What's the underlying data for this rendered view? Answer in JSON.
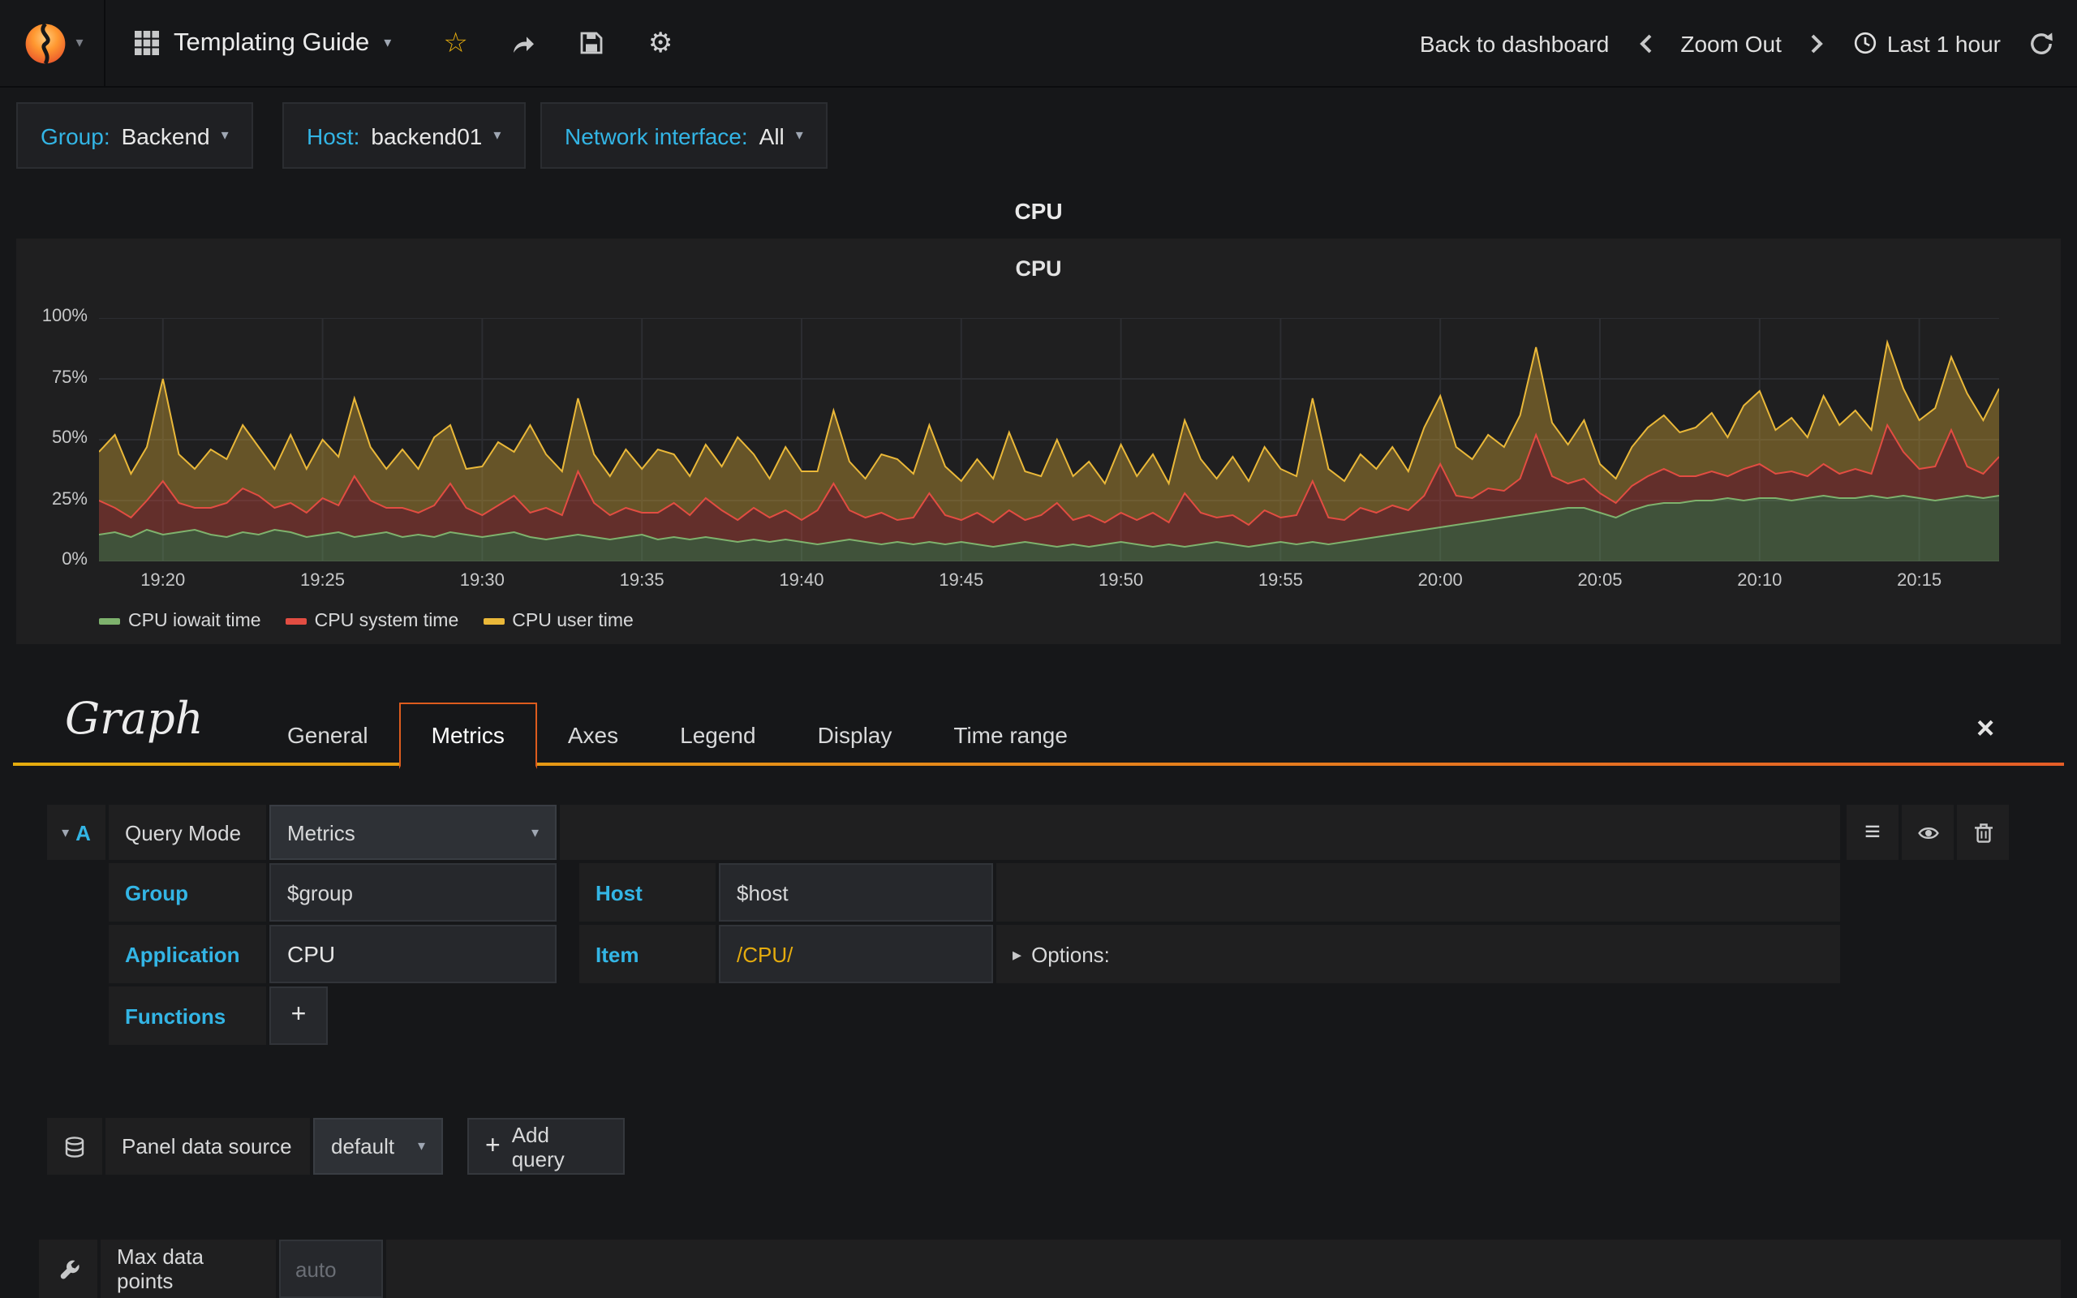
{
  "navbar": {
    "dashboard_title": "Templating Guide",
    "back_to_dashboard": "Back to dashboard",
    "zoom_out": "Zoom Out",
    "time_range": "Last 1 hour"
  },
  "icons": {
    "star": "☆",
    "gear": "⚙",
    "caret_down": "▾",
    "caret_right": "▸",
    "close": "×",
    "plus": "+",
    "hamburger": "≡"
  },
  "colors": {
    "accent_cyan": "#33b5e5",
    "accent_orange": "#e55e27",
    "regex_yellow": "#e5ac0e",
    "panel_bg": "#1f1f20",
    "page_bg": "#161719"
  },
  "variables": [
    {
      "label": "Group:",
      "value": "Backend"
    },
    {
      "label": "Host:",
      "value": "backend01"
    },
    {
      "label": "Network interface:",
      "value": "All"
    }
  ],
  "panel": {
    "title": "CPU",
    "chart_title": "CPU"
  },
  "chart_data": {
    "type": "area",
    "stacked": true,
    "title": "CPU",
    "ylabel": "",
    "xlabel": "",
    "unit": "%",
    "ylim": [
      0,
      100
    ],
    "yticks": [
      "0%",
      "25%",
      "50%",
      "75%",
      "100%"
    ],
    "x_start": "19:18",
    "span_minutes": 59.5,
    "xticks": [
      {
        "min": 2,
        "label": "19:20"
      },
      {
        "min": 7,
        "label": "19:25"
      },
      {
        "min": 12,
        "label": "19:30"
      },
      {
        "min": 17,
        "label": "19:35"
      },
      {
        "min": 22,
        "label": "19:40"
      },
      {
        "min": 27,
        "label": "19:45"
      },
      {
        "min": 32,
        "label": "19:50"
      },
      {
        "min": 37,
        "label": "19:55"
      },
      {
        "min": 42,
        "label": "20:00"
      },
      {
        "min": 47,
        "label": "20:05"
      },
      {
        "min": 52,
        "label": "20:10"
      },
      {
        "min": 57,
        "label": "20:15"
      }
    ],
    "legend_position": "bottom-left",
    "series": [
      {
        "name": "CPU iowait time",
        "color": "#7EB26D",
        "values": [
          11,
          12,
          10,
          13,
          11,
          12,
          13,
          11,
          10,
          12,
          11,
          13,
          12,
          10,
          11,
          12,
          10,
          11,
          12,
          10,
          11,
          10,
          12,
          11,
          10,
          11,
          12,
          10,
          9,
          10,
          11,
          10,
          9,
          10,
          11,
          9,
          10,
          9,
          10,
          9,
          8,
          9,
          8,
          9,
          8,
          7,
          8,
          9,
          8,
          7,
          8,
          7,
          8,
          7,
          8,
          7,
          6,
          7,
          8,
          7,
          6,
          7,
          6,
          7,
          8,
          7,
          6,
          7,
          6,
          7,
          8,
          7,
          6,
          7,
          8,
          7,
          8,
          7,
          8,
          9,
          10,
          11,
          12,
          13,
          14,
          15,
          16,
          17,
          18,
          19,
          20,
          21,
          22,
          22,
          20,
          18,
          21,
          23,
          24,
          24,
          25,
          25,
          26,
          25,
          26,
          26,
          25,
          26,
          27,
          26,
          26,
          27,
          26,
          27,
          26,
          25,
          26,
          27,
          26,
          27
        ]
      },
      {
        "name": "CPU system time",
        "color": "#E24D42",
        "values": [
          14,
          10,
          8,
          12,
          22,
          12,
          9,
          11,
          14,
          18,
          16,
          9,
          12,
          10,
          15,
          11,
          25,
          14,
          10,
          12,
          9,
          13,
          20,
          11,
          9,
          12,
          15,
          10,
          13,
          9,
          26,
          14,
          10,
          12,
          9,
          11,
          14,
          10,
          16,
          12,
          9,
          13,
          10,
          12,
          9,
          14,
          24,
          12,
          10,
          13,
          9,
          11,
          20,
          12,
          9,
          13,
          10,
          14,
          9,
          12,
          18,
          10,
          13,
          9,
          12,
          10,
          14,
          9,
          22,
          13,
          10,
          12,
          9,
          14,
          10,
          12,
          25,
          11,
          9,
          13,
          10,
          12,
          9,
          14,
          26,
          12,
          10,
          13,
          11,
          15,
          32,
          14,
          10,
          12,
          8,
          6,
          10,
          12,
          14,
          11,
          10,
          12,
          9,
          13,
          14,
          10,
          12,
          9,
          13,
          10,
          12,
          9,
          30,
          18,
          12,
          14,
          28,
          12,
          10,
          16
        ]
      },
      {
        "name": "CPU user time",
        "color": "#EAB839",
        "values": [
          20,
          30,
          18,
          22,
          42,
          20,
          16,
          24,
          18,
          26,
          20,
          16,
          28,
          18,
          24,
          20,
          32,
          22,
          16,
          24,
          18,
          28,
          24,
          16,
          20,
          26,
          18,
          36,
          22,
          18,
          30,
          20,
          16,
          24,
          18,
          26,
          20,
          16,
          22,
          18,
          34,
          22,
          16,
          26,
          20,
          16,
          30,
          20,
          16,
          24,
          25,
          18,
          28,
          20,
          16,
          22,
          18,
          32,
          20,
          16,
          26,
          18,
          22,
          16,
          28,
          18,
          24,
          16,
          30,
          22,
          16,
          24,
          18,
          26,
          20,
          16,
          34,
          20,
          16,
          22,
          18,
          24,
          16,
          28,
          28,
          20,
          16,
          22,
          18,
          26,
          36,
          22,
          16,
          24,
          12,
          10,
          16,
          20,
          22,
          18,
          20,
          24,
          16,
          26,
          30,
          18,
          22,
          16,
          28,
          20,
          24,
          18,
          34,
          26,
          20,
          24,
          30,
          30,
          22,
          28
        ]
      }
    ]
  },
  "editor": {
    "panel_type": "Graph",
    "tabs": [
      "General",
      "Metrics",
      "Axes",
      "Legend",
      "Display",
      "Time range"
    ],
    "active_tab": "Metrics",
    "query": {
      "letter": "A",
      "query_mode_label": "Query Mode",
      "query_mode_value": "Metrics",
      "group_label": "Group",
      "group_value": "$group",
      "host_label": "Host",
      "host_value": "$host",
      "application_label": "Application",
      "application_value": "CPU",
      "item_label": "Item",
      "item_value": "/CPU/",
      "options_label": "Options:",
      "functions_label": "Functions"
    },
    "datasource": {
      "label": "Panel data source",
      "value": "default",
      "add_query": "Add query"
    },
    "max_data_points": {
      "label": "Max data points",
      "placeholder": "auto"
    }
  }
}
